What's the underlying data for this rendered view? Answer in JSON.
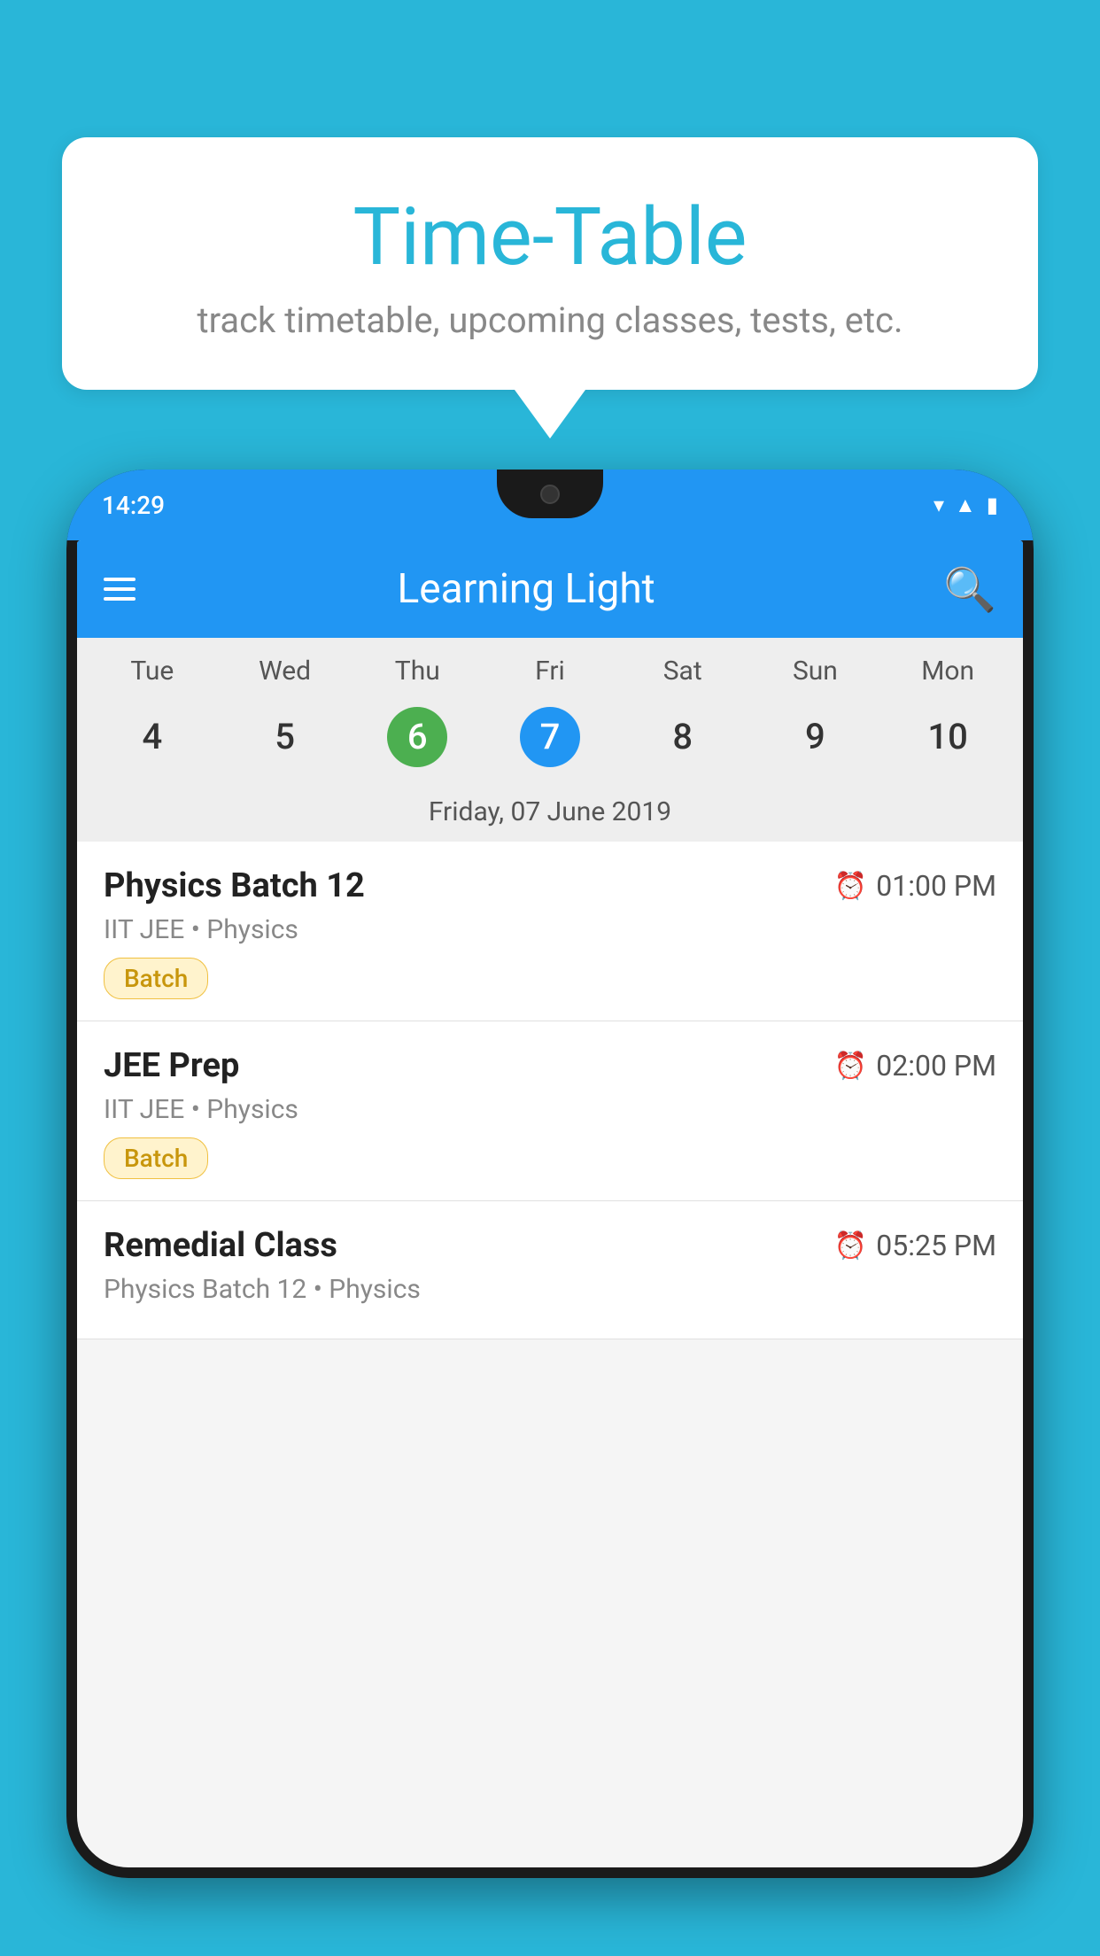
{
  "background_color": "#29B6D8",
  "speech_bubble": {
    "title": "Time-Table",
    "subtitle": "track timetable, upcoming classes, tests, etc."
  },
  "phone": {
    "status_bar": {
      "time": "14:29",
      "icons": [
        "wifi",
        "signal",
        "battery"
      ]
    },
    "app_bar": {
      "title": "Learning Light",
      "hamburger_label": "menu",
      "search_label": "search"
    },
    "calendar": {
      "days": [
        "Tue",
        "Wed",
        "Thu",
        "Fri",
        "Sat",
        "Sun",
        "Mon"
      ],
      "dates": [
        "4",
        "5",
        "6",
        "7",
        "8",
        "9",
        "10"
      ],
      "today_index": 2,
      "selected_index": 3,
      "selected_label": "Friday, 07 June 2019"
    },
    "schedule": [
      {
        "title": "Physics Batch 12",
        "time": "01:00 PM",
        "subtitle": "IIT JEE • Physics",
        "badge": "Batch"
      },
      {
        "title": "JEE Prep",
        "time": "02:00 PM",
        "subtitle": "IIT JEE • Physics",
        "badge": "Batch"
      },
      {
        "title": "Remedial Class",
        "time": "05:25 PM",
        "subtitle": "Physics Batch 12 • Physics",
        "badge": ""
      }
    ]
  }
}
